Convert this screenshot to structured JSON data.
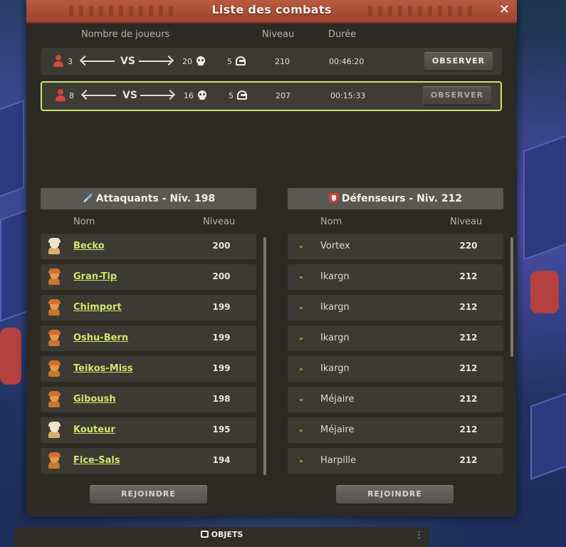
{
  "window": {
    "title": "Liste des combats",
    "close_icon": "close-icon"
  },
  "fight_list": {
    "headers": {
      "players": "Nombre de joueurs",
      "level": "Niveau",
      "duration": "Durée"
    },
    "fights": [
      {
        "attackers": "3",
        "vs": "VS",
        "defenders": "20",
        "spectators": "5",
        "level": "210",
        "duration": "00:46:20",
        "button": "OBSERVER",
        "selected": false
      },
      {
        "attackers": "8",
        "vs": "VS",
        "defenders": "16",
        "spectators": "5",
        "level": "207",
        "duration": "00:15:33",
        "button": "OBSERVER",
        "selected": true
      }
    ]
  },
  "attackers": {
    "title": "Attaquants - Niv. 198",
    "col_name": "Nom",
    "col_level": "Niveau",
    "join_button": "REJOINDRE",
    "players": [
      {
        "name": "Becko",
        "level": "200",
        "avatar": "white"
      },
      {
        "name": "Gran-Tip",
        "level": "200",
        "avatar": "orange"
      },
      {
        "name": "Chimport",
        "level": "199",
        "avatar": "orange"
      },
      {
        "name": "Oshu-Bern",
        "level": "199",
        "avatar": "orange"
      },
      {
        "name": "Teikos-Miss",
        "level": "199",
        "avatar": "orange"
      },
      {
        "name": "Giboush",
        "level": "198",
        "avatar": "orange"
      },
      {
        "name": "Kouteur",
        "level": "195",
        "avatar": "white"
      },
      {
        "name": "Fice-Sals",
        "level": "194",
        "avatar": "orange"
      }
    ]
  },
  "defenders": {
    "title": "Défenseurs - Niv. 212",
    "col_name": "Nom",
    "col_level": "Niveau",
    "join_button": "REJOINDRE",
    "players": [
      {
        "name": "Vortex",
        "level": "220"
      },
      {
        "name": "Ikargn",
        "level": "212"
      },
      {
        "name": "Ikargn",
        "level": "212"
      },
      {
        "name": "Ikargn",
        "level": "212"
      },
      {
        "name": "Ikargn",
        "level": "212"
      },
      {
        "name": "Méjaire",
        "level": "212"
      },
      {
        "name": "Méjaire",
        "level": "212"
      },
      {
        "name": "Harpille",
        "level": "212"
      }
    ]
  },
  "bottom_bar": {
    "label": "OBJETS",
    "icon": "bag-icon",
    "menu_icon": "more-icon"
  },
  "colors": {
    "title_bar": "#b85a40",
    "accent_link": "#cde66a",
    "selected_border": "#c8e56b",
    "panel_bg": "#2b2a25",
    "row_bg": "#3b3a34"
  }
}
